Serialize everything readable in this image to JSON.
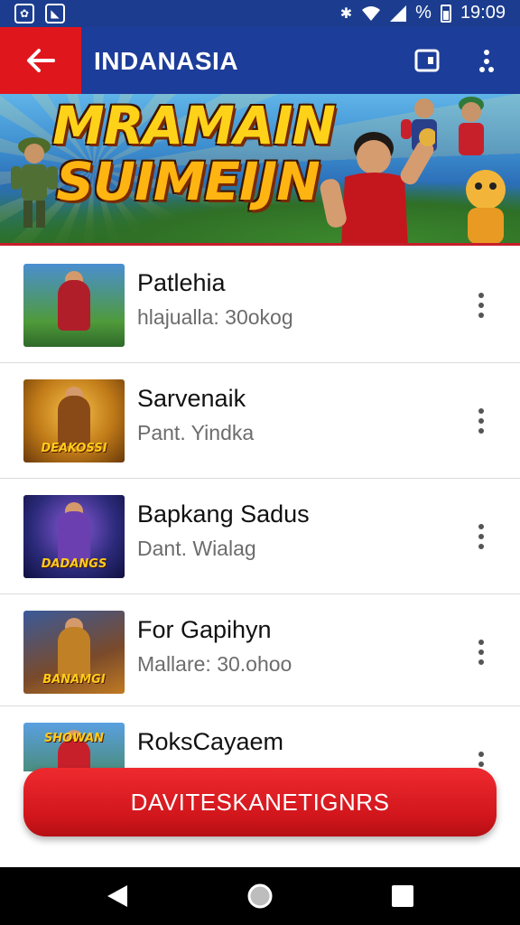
{
  "status_bar": {
    "time": "19:09",
    "percent_sign": "%",
    "icons": [
      "app-icon-1",
      "app-icon-2",
      "bluetooth-icon",
      "wifi-icon",
      "cell-signal-icon",
      "battery-icon"
    ]
  },
  "app_bar": {
    "title": "INDANASIA",
    "back_icon": "arrow-left-icon",
    "actions": [
      "cast-icon",
      "more-vert-icon"
    ],
    "colors": {
      "bar": "#1d3d9a",
      "back": "#e0161d"
    }
  },
  "banner": {
    "line1": "MRAMAIN",
    "line2": "SUIMEIJN"
  },
  "list": {
    "items": [
      {
        "title": "Patlehia",
        "subtitle": "hlajualla: 30okog",
        "thumb_bg": "#3f7f3a",
        "thumb_fig": "#b01e2a",
        "thumb_text": ""
      },
      {
        "title": "Sarvenaik",
        "subtitle": "Pant. Yindka",
        "thumb_bg": "#b9781a",
        "thumb_fig": "#8a4a18",
        "thumb_text": "DEAKOSSI"
      },
      {
        "title": "Bapkang Sadus",
        "subtitle": "Dant. Wialag",
        "thumb_bg": "#2b2a7a",
        "thumb_fig": "#6b3fb0",
        "thumb_text": "DADANGS"
      },
      {
        "title": "For Gapihyn",
        "subtitle": "Mallare: 30.ohoo",
        "thumb_bg": "#3a5a9a",
        "thumb_fig": "#c08026",
        "thumb_text": "BANAMGI"
      },
      {
        "title": "RoksCayaem",
        "subtitle": "",
        "thumb_bg": "#4f8ed0",
        "thumb_fig": "#c7202a",
        "thumb_text": "SHOWAN"
      }
    ]
  },
  "cta": {
    "label": "DAVITESKANETIGNRS",
    "color": "#e0161d"
  },
  "nav_bar": {
    "icons": [
      "nav-back-icon",
      "nav-home-icon",
      "nav-recents-icon"
    ]
  }
}
